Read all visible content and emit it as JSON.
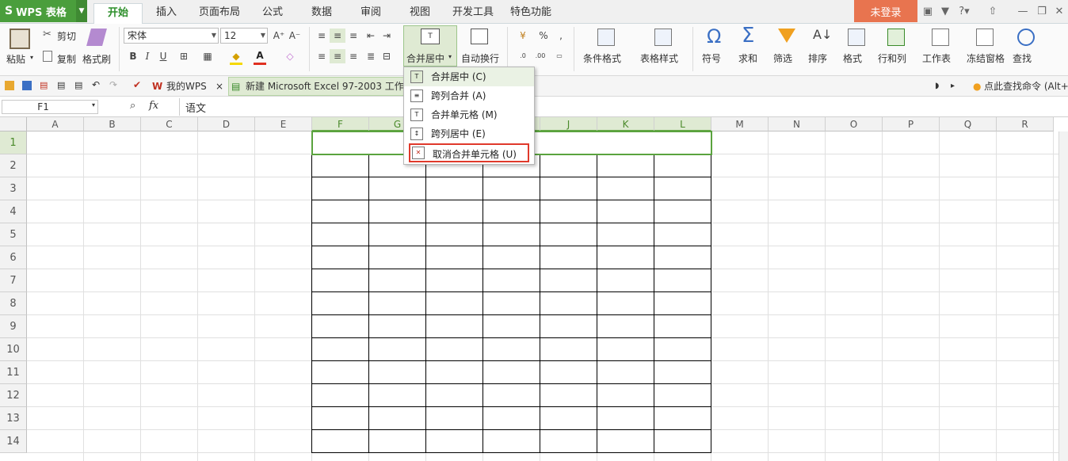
{
  "app": {
    "name": "WPS 表格",
    "login": "未登录"
  },
  "menu_tabs": [
    "开始",
    "插入",
    "页面布局",
    "公式",
    "数据",
    "审阅",
    "视图",
    "开发工具",
    "特色功能"
  ],
  "ribbon": {
    "paste": "粘贴",
    "cut": "剪切",
    "copy": "复制",
    "format_painter": "格式刷",
    "font_name": "宋体",
    "font_size": "12",
    "merge_center": "合并居中",
    "wrap_text": "自动换行",
    "conditional_format": "条件格式",
    "table_style": "表格样式",
    "symbol": "符号",
    "sum": "求和",
    "filter": "筛选",
    "sort": "排序",
    "format": "格式",
    "rows_cols": "行和列",
    "worksheet": "工作表",
    "freeze": "冻结窗格",
    "find": "查找",
    "sum_glyph": "Σ",
    "omega_glyph": "Ω"
  },
  "quickbar": {
    "my_wps": "我的WPS",
    "doc_tab": "新建 Microsoft Excel 97-2003 工作",
    "search_cmd": "点此查找命令 (Alt+C"
  },
  "formula_bar": {
    "name_box": "F1",
    "fx": "fx",
    "value": "语文"
  },
  "columns": [
    "A",
    "B",
    "C",
    "D",
    "E",
    "F",
    "G",
    "H",
    "I",
    "J",
    "K",
    "L",
    "M",
    "N",
    "O",
    "P",
    "Q",
    "R"
  ],
  "rows": [
    "1",
    "2",
    "3",
    "4",
    "5",
    "6",
    "7",
    "8",
    "9",
    "10",
    "11",
    "12",
    "13",
    "14"
  ],
  "dropdown": [
    {
      "label": "合并居中 (C)"
    },
    {
      "label": "跨列合并 (A)"
    },
    {
      "label": "合并单元格 (M)"
    },
    {
      "label": "跨列居中 (E)"
    },
    {
      "label": "取消合并单元格 (U)"
    }
  ],
  "colors": {
    "accent": "#4a9e3c",
    "login_bg": "#e8744f",
    "highlight": "#e0392b"
  }
}
